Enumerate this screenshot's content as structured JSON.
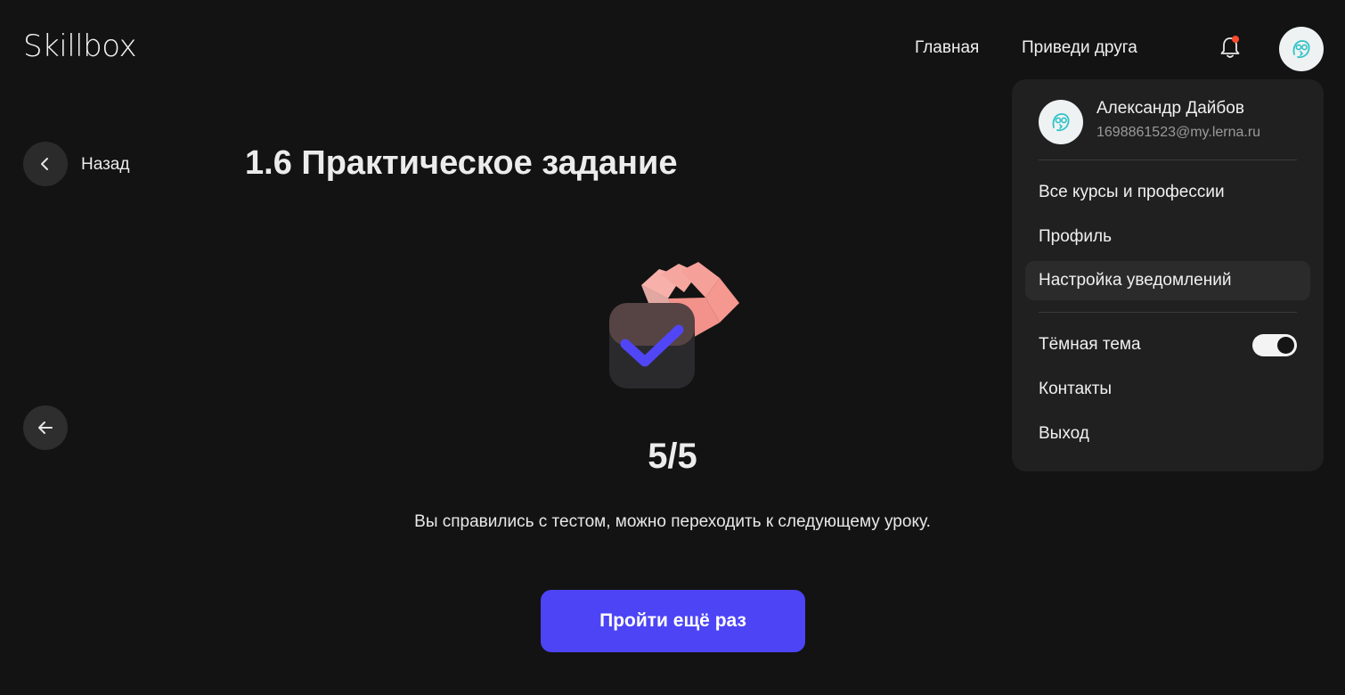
{
  "header": {
    "logo": "Skillbox",
    "nav": [
      "Главная",
      "Приведи друга"
    ],
    "has_notification": true
  },
  "back": {
    "label": "Назад"
  },
  "lesson": {
    "title": "1.6 Практическое задание",
    "score": "5/5",
    "message": "Вы справились с тестом, можно переходить к следующему уроку.",
    "retry_label": "Пройти ещё раз"
  },
  "user_menu": {
    "name": "Александр Дайбов",
    "email": "1698861523@my.lerna.ru",
    "items": [
      "Все курсы и профессии",
      "Профиль",
      "Настройка уведомлений"
    ],
    "theme_label": "Тёмная тема",
    "dark_theme": true,
    "bottom_items": [
      "Контакты",
      "Выход"
    ]
  },
  "colors": {
    "background": "#131313",
    "accent": "#4d44f6",
    "menu_bg": "#202020",
    "notification": "#ff4b2e",
    "illustration_pink": "#f6a09a"
  }
}
